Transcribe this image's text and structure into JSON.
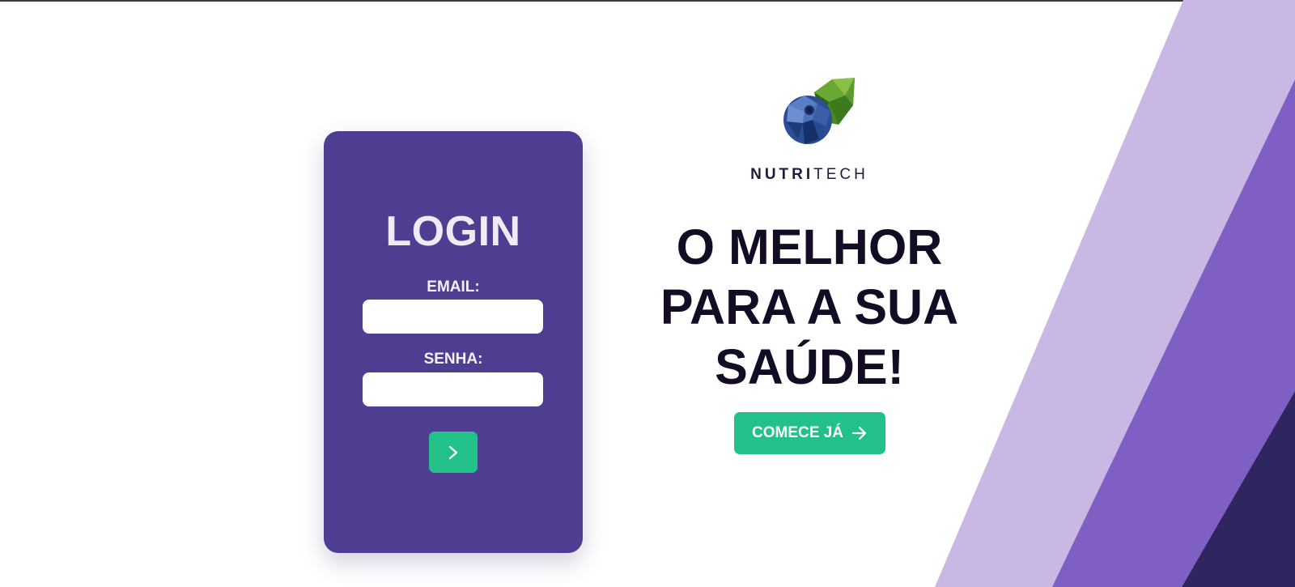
{
  "login_card": {
    "title": "LOGIN",
    "email_label": "EMAIL:",
    "email_value": "",
    "password_label": "SENHA:",
    "password_value": "",
    "submit_icon": "chevron-right-icon"
  },
  "hero": {
    "brand_bold": "NUTRI",
    "brand_light": "TECH",
    "logo_icon": "blueberry-leaf-logo",
    "headline_lines": [
      "O MELHOR",
      "PARA A SUA",
      "SAÚDE!"
    ],
    "cta_label": "COMECE JÁ",
    "cta_icon": "arrow-right-icon"
  },
  "colors": {
    "card_background": "#4f3d91",
    "accent_green": "#22c18a",
    "headline_text": "#130c24",
    "stripe_light": "#c9b8e4",
    "stripe_medium": "#7f5fc3",
    "stripe_dark": "#2f2660"
  }
}
